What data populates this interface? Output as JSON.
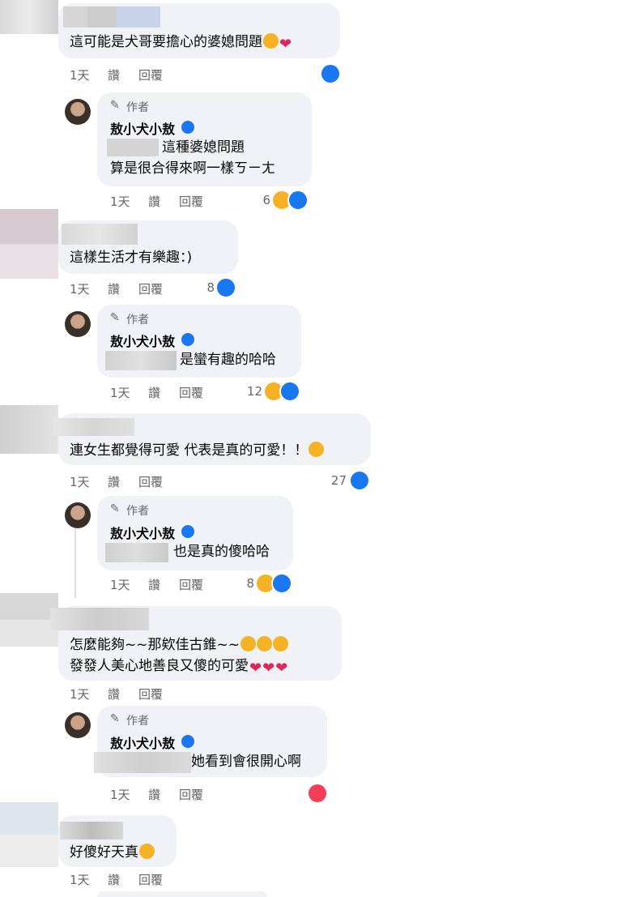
{
  "meta_labels": {
    "time": "1天",
    "like": "讚",
    "reply": "回覆"
  },
  "author_badge": "作者",
  "author_name": "敖小犬小敖",
  "comments": [
    {
      "text": "這可能是犬哥要擔心的婆媳問題"
    },
    {
      "reply_lines": [
        "這種婆媳問題",
        "算是很合得來啊一樣ㄎㄧㄤ"
      ],
      "count": "6"
    },
    {
      "text": "這樣生活才有樂趣：)",
      "count": "8"
    },
    {
      "reply_lines": [
        "是蠻有趣的哈哈"
      ],
      "count": "12"
    },
    {
      "text": "連女生都覺得可愛 代表是真的可愛！！",
      "count": "27"
    },
    {
      "reply_lines": [
        "也是真的傻哈哈"
      ],
      "count": "8"
    },
    {
      "lines": [
        "怎麼能夠~~那欸佳古錐~~",
        "發發人美心地善良又傻的可愛"
      ]
    },
    {
      "reply_lines": [
        "她看到會很開心啊"
      ]
    },
    {
      "text": "好傻好天真"
    }
  ],
  "colors": {
    "like_blue": "#1877f2",
    "haha_yellow": "#f7b125",
    "love_red": "#f33e58",
    "bubble": "#f0f2f5",
    "verified": "#1877f2"
  },
  "icons": [
    "pencil-icon",
    "verified-badge-icon",
    "like-reaction-icon",
    "haha-reaction-icon",
    "love-reaction-icon",
    "laughing-emoji-icon",
    "rolling-laughing-emoji-icon",
    "heart-emoji-icon",
    "heart-eyes-emoji-icon"
  ]
}
